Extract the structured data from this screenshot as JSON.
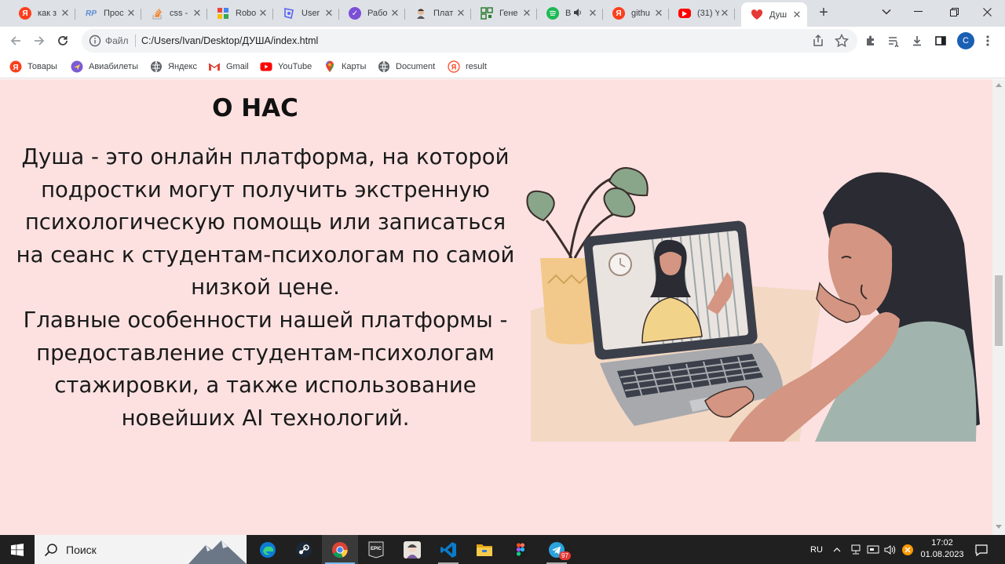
{
  "browser": {
    "tabs": [
      {
        "title": "как з",
        "icon": "yandex-icon",
        "color": "#fc3f1d"
      },
      {
        "title": "Прос",
        "icon": "rp-icon",
        "color": "#5b8dd6"
      },
      {
        "title": "css -",
        "icon": "stackoverflow-icon",
        "color": "#f48024"
      },
      {
        "title": "Robo",
        "icon": "robo-icon",
        "color": "#e8453c"
      },
      {
        "title": "User",
        "icon": "user-icon",
        "color": "#5865f2"
      },
      {
        "title": "Рабо",
        "icon": "check-shield-icon",
        "color": "#7b4fd6"
      },
      {
        "title": "Плат",
        "icon": "avatar-icon",
        "color": "#444444"
      },
      {
        "title": "Гене",
        "icon": "qr-icon",
        "color": "#2e7d32"
      },
      {
        "title": "В",
        "icon": "spotify-icon",
        "color": "#1db954"
      },
      {
        "title": "githu",
        "icon": "yandex-icon",
        "color": "#fc3f1d"
      },
      {
        "title": "(31) Y",
        "icon": "youtube-icon",
        "color": "#ff0000"
      },
      {
        "title": "Душ",
        "icon": "heart-icon",
        "color": "#e53935"
      }
    ],
    "address_scheme": "Файл",
    "address_url": "C:/Users/Ivan/Desktop/ДУША/index.html",
    "profile_initial": "C",
    "bookmarks": [
      {
        "label": "Товары",
        "icon": "yandex-icon"
      },
      {
        "label": "Авиабилеты",
        "icon": "avia-icon"
      },
      {
        "label": "Яндекс",
        "icon": "globe-icon"
      },
      {
        "label": "Gmail",
        "icon": "gmail-icon"
      },
      {
        "label": "YouTube",
        "icon": "youtube-icon"
      },
      {
        "label": "Карты",
        "icon": "maps-pin-icon"
      },
      {
        "label": "Document",
        "icon": "globe-icon"
      },
      {
        "label": "result",
        "icon": "yandex-outline-icon"
      }
    ]
  },
  "page": {
    "heading": "О НАС",
    "paragraph_1": "Душа - это онлайн платформа, на которой подростки могут получить экстренную психологическую помощь или записаться на сеанс к студентам-психологам по самой низкой цене.",
    "paragraph_2": "Главные особенности нашей платформы - предоставление студентам-психологам стажировки, а также использование новейших AI технологий.",
    "background_color": "#fde1e1"
  },
  "taskbar": {
    "search_placeholder": "Поиск",
    "language": "RU",
    "time": "17:02",
    "date": "01.08.2023",
    "telegram_badge": "97"
  }
}
